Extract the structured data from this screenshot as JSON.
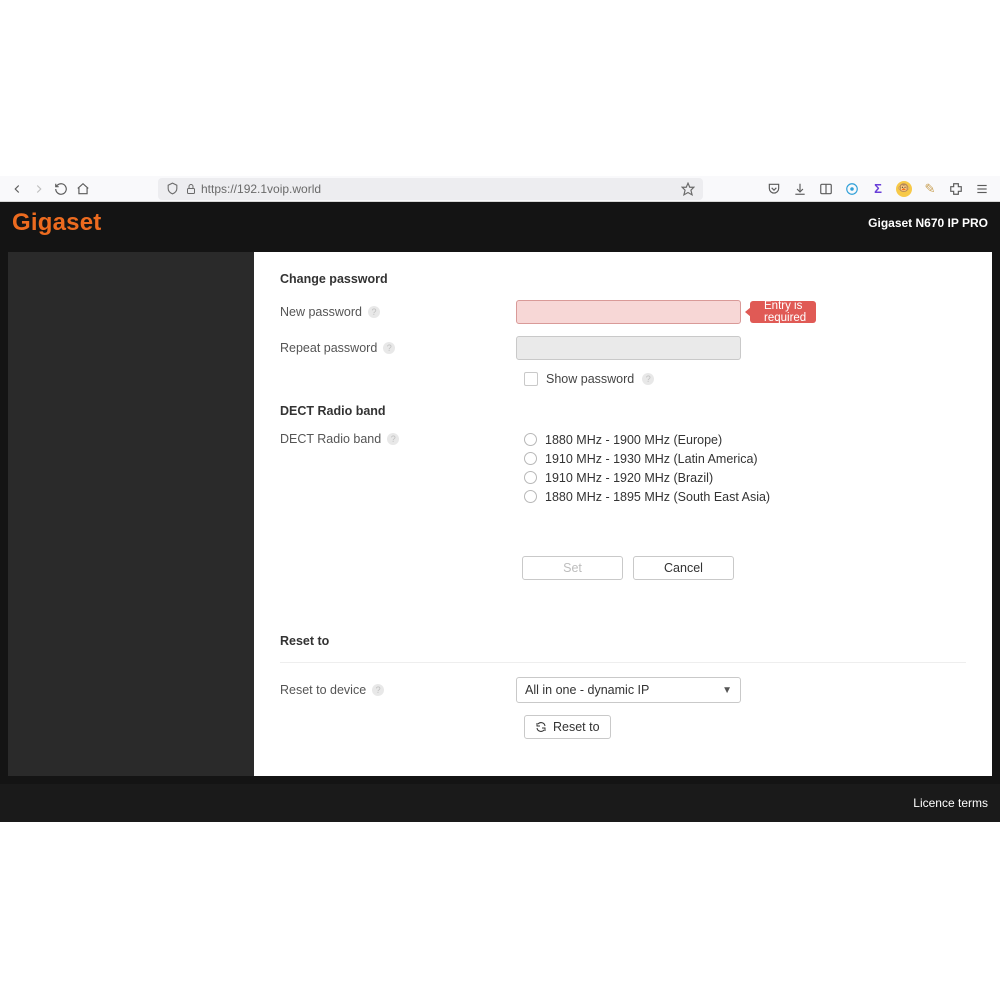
{
  "browser": {
    "url": "https://192.1voip.world"
  },
  "header": {
    "brand": "Gigaset",
    "device": "Gigaset N670 IP PRO"
  },
  "sections": {
    "change_password": {
      "title": "Change password",
      "new_password_label": "New password",
      "repeat_password_label": "Repeat password",
      "error_text": "Entry is required",
      "show_password_label": "Show password"
    },
    "dect": {
      "title": "DECT Radio band",
      "field_label": "DECT Radio band",
      "options": [
        "1880 MHz - 1900 MHz (Europe)",
        "1910 MHz - 1930 MHz (Latin America)",
        "1910 MHz - 1920 MHz (Brazil)",
        "1880 MHz - 1895 MHz (South East Asia)"
      ]
    },
    "buttons": {
      "set": "Set",
      "cancel": "Cancel"
    },
    "reset": {
      "title": "Reset to",
      "field_label": "Reset to device",
      "selected": "All in one - dynamic IP",
      "action_label": "Reset to"
    }
  },
  "footer": {
    "licence": "Licence terms"
  }
}
